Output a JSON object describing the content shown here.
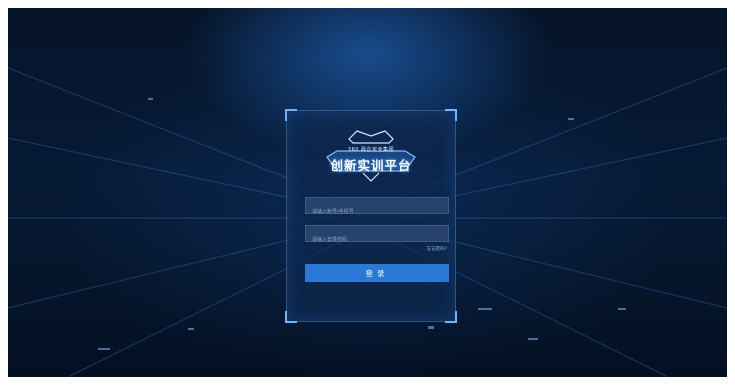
{
  "app": {
    "logo_sub": "360 政企安全集团",
    "logo_main": "创新实训平台"
  },
  "login": {
    "username_placeholder": "请输入账号/手机号",
    "password_placeholder": "请输入登录密码",
    "forgot_label": "忘记密码?",
    "submit_label": "登录"
  },
  "colors": {
    "background": "#061a35",
    "panel": "#0e284e",
    "accent": "#2a79d6",
    "corner": "#6fb4ff"
  }
}
